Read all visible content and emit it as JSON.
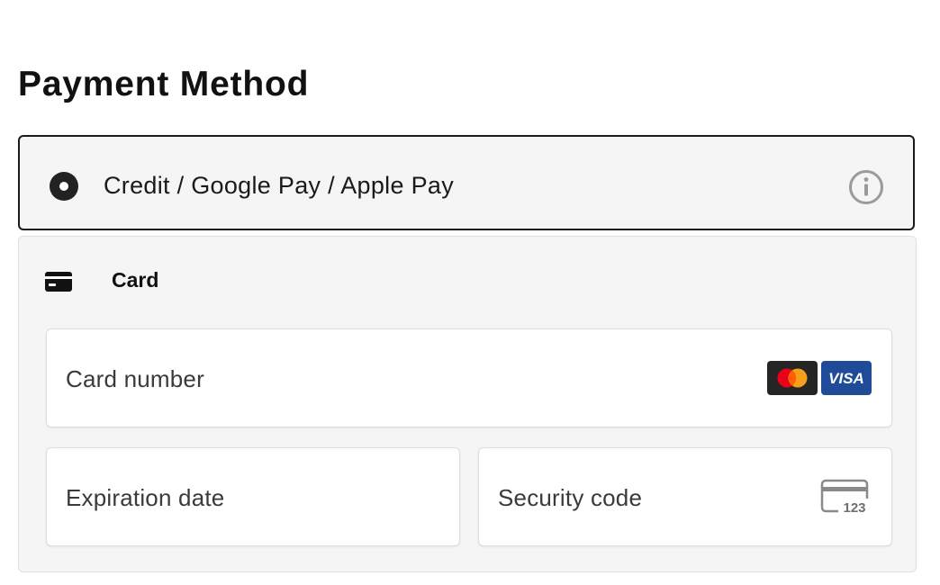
{
  "page_title": "Payment Method",
  "payment_option": {
    "label": "Credit / Google Pay / Apple Pay",
    "selected": true
  },
  "card_section": {
    "label": "Card",
    "fields": {
      "card_number": {
        "placeholder": "Card number",
        "value": ""
      },
      "expiration_date": {
        "placeholder": "Expiration date",
        "value": ""
      },
      "security_code": {
        "placeholder": "Security code",
        "value": ""
      }
    },
    "brands": [
      {
        "name": "mastercard",
        "icon": "mastercard-logo"
      },
      {
        "name": "VISA",
        "icon": "visa-logo"
      }
    ],
    "cvc_icon_text": "123"
  },
  "icons": {
    "info": "info-icon",
    "card": "credit-card-icon",
    "cvc": "card-back-cvc-icon"
  },
  "colors": {
    "selected_border": "#1a1a1a",
    "panel_background": "#f5f5f5",
    "visa_blue": "#1f4b99",
    "mastercard_red": "#eb001b",
    "mastercard_orange": "#f79e1b"
  }
}
